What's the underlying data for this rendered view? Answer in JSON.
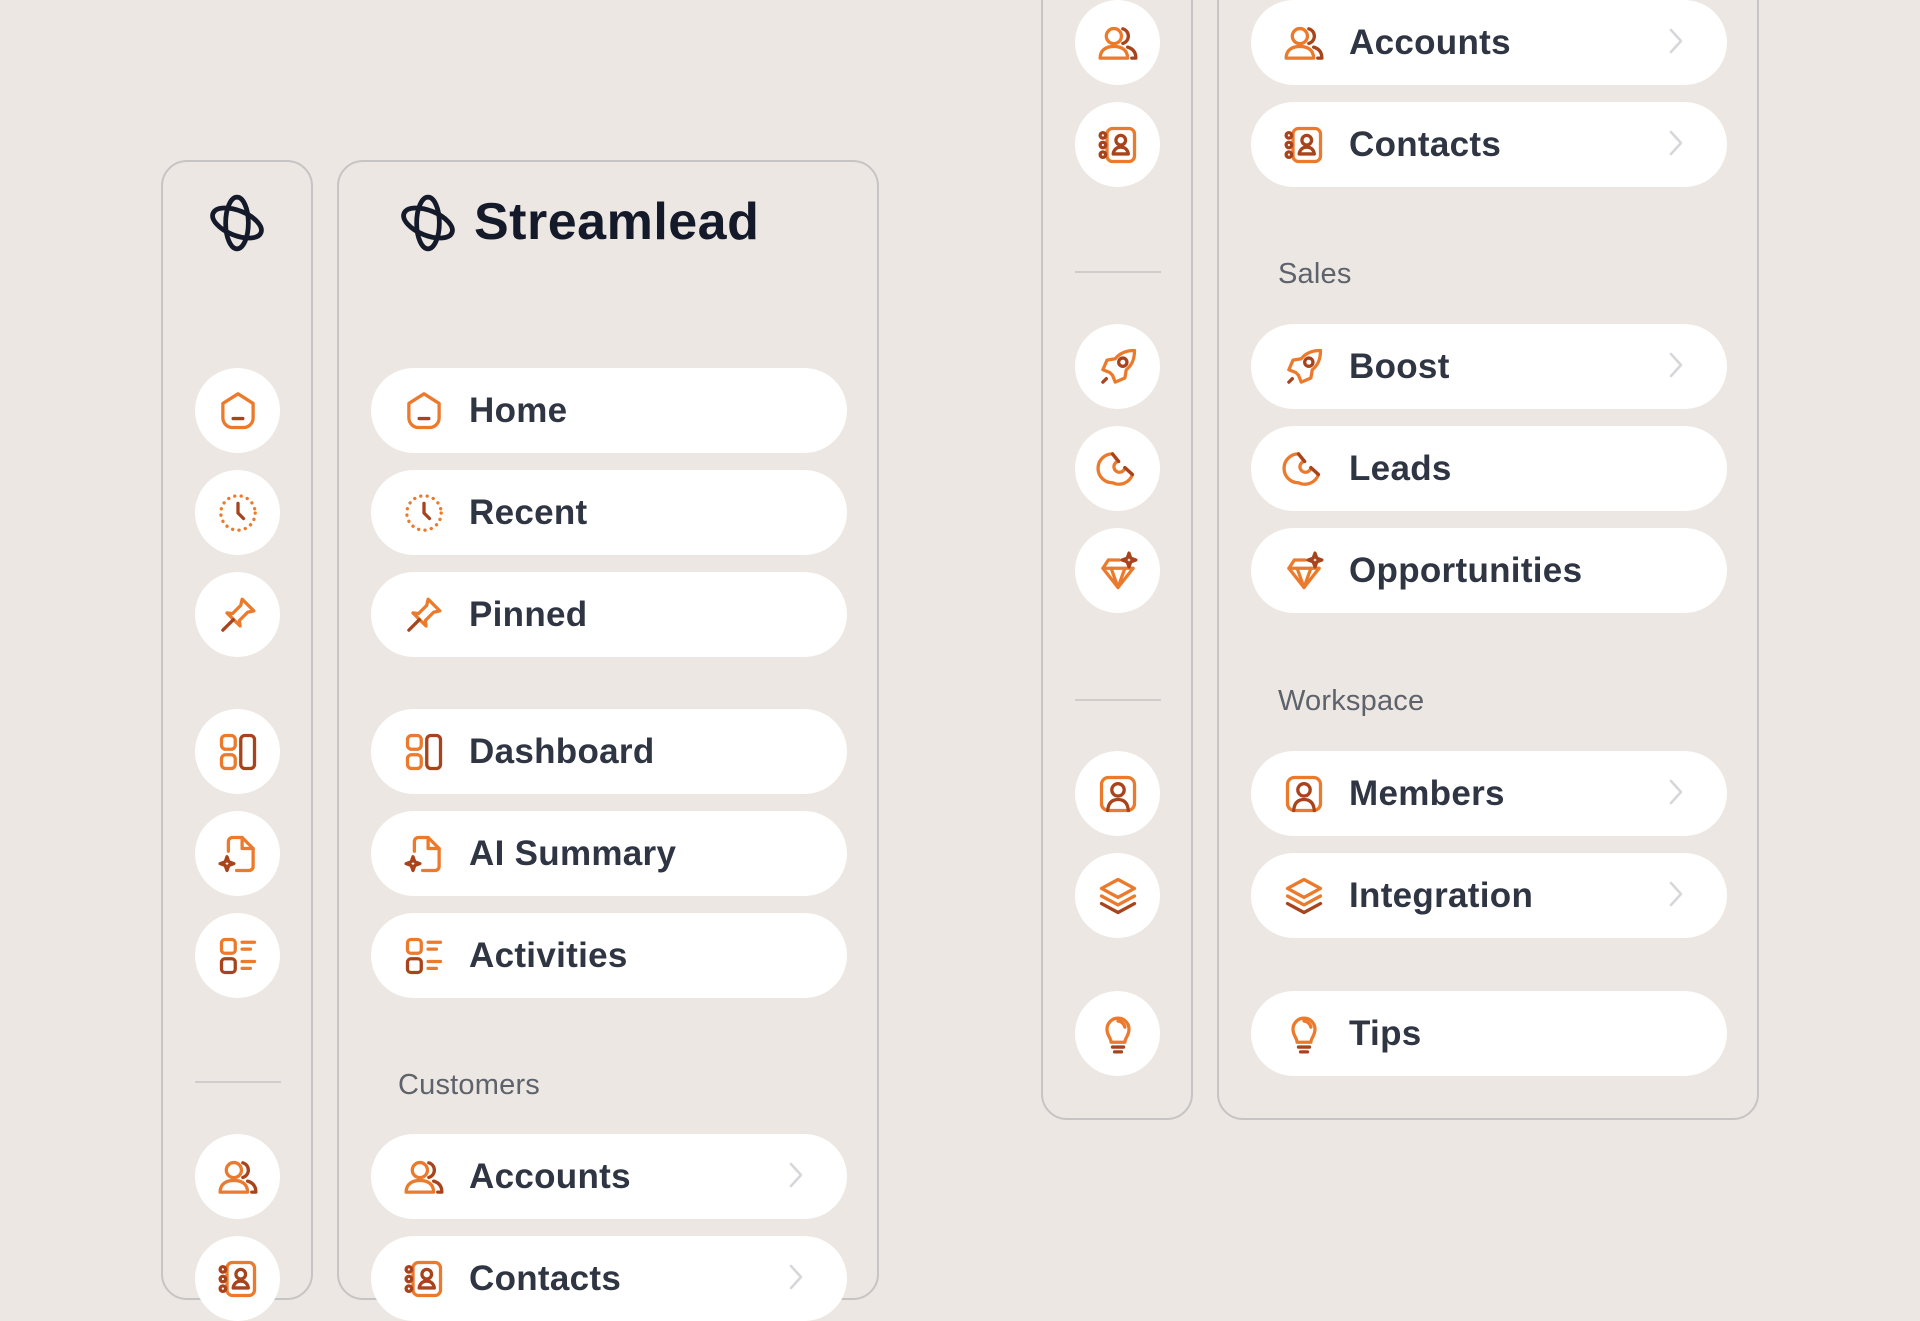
{
  "brand": {
    "name": "Streamlead",
    "logo_icon": "orbit-logo-icon"
  },
  "colors": {
    "accent": "#ec7a2c",
    "accent_dark": "#a8431c",
    "text": "#2f3542",
    "muted": "#5d626b",
    "background": "#ece7e2",
    "panel_border": "#c6c4c4"
  },
  "nav": {
    "home": "Home",
    "recent": "Recent",
    "pinned": "Pinned",
    "dashboard": "Dashboard",
    "ai_summary": "AI Summary",
    "activities": "Activities",
    "accounts": "Accounts",
    "contacts": "Contacts",
    "boost": "Boost",
    "leads": "Leads",
    "opportunities": "Opportunities",
    "members": "Members",
    "integration": "Integration",
    "tips": "Tips"
  },
  "sections": {
    "customers": "Customers",
    "sales": "Sales",
    "workspace": "Workspace"
  },
  "icons": [
    "home-icon",
    "clock-icon",
    "pin-icon",
    "dashboard-icon",
    "ai-document-icon",
    "activities-icon",
    "users-icon",
    "contact-book-icon",
    "rocket-icon",
    "magnet-icon",
    "diamond-icon",
    "member-icon",
    "layers-icon",
    "lightbulb-icon",
    "chevron-right-icon"
  ]
}
